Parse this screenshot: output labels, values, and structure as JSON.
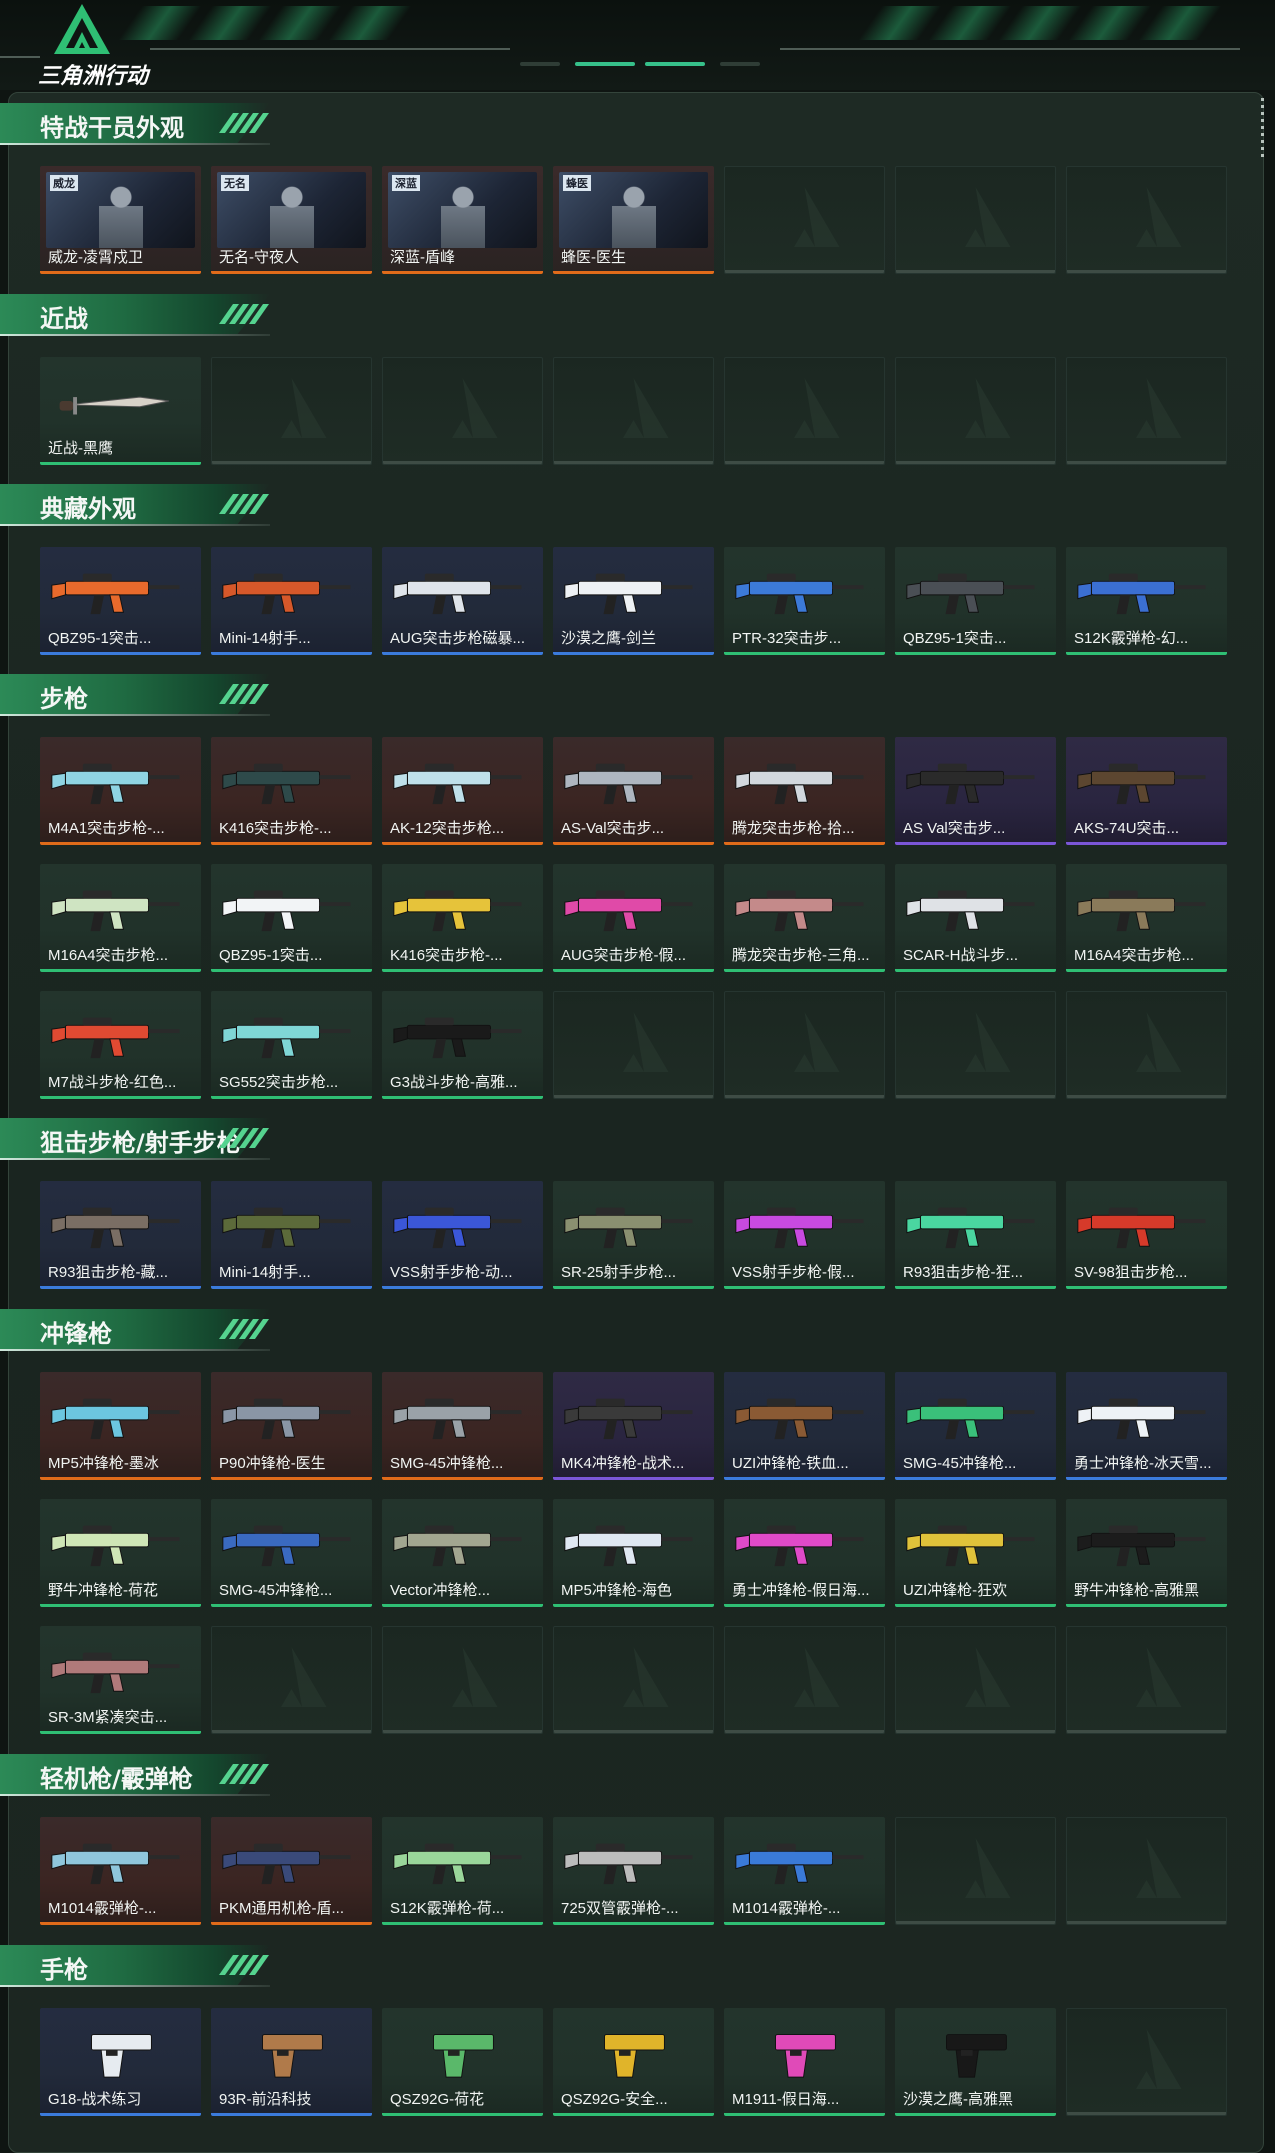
{
  "app": {
    "logo_text": "三角洲行动"
  },
  "colors": {
    "red": "#e06b1a",
    "blue": "#3b7bdc",
    "green": "#2fbf74",
    "purple": "#7b56d8",
    "gold": "#e6a226",
    "section_header": "#1f6b42"
  },
  "sections": [
    {
      "title": "特战干员外观",
      "items": [
        {
          "name": "威龙-凌霄戍卫",
          "rarity": "operator",
          "badge": "威龙"
        },
        {
          "name": "无名-守夜人",
          "rarity": "operator",
          "badge": "无名"
        },
        {
          "name": "深蓝-盾峰",
          "rarity": "operator",
          "badge": "深蓝"
        },
        {
          "name": "蜂医-医生",
          "rarity": "operator",
          "badge": "蜂医"
        },
        null,
        null,
        null
      ]
    },
    {
      "title": "近战",
      "items": [
        {
          "name": "近战-黑鹰",
          "rarity": "green"
        },
        null,
        null,
        null,
        null,
        null,
        null
      ]
    },
    {
      "title": "典藏外观",
      "items": [
        {
          "name": "QBZ95-1突击...",
          "rarity": "blue",
          "color": "#e86a2c"
        },
        {
          "name": "Mini-14射手...",
          "rarity": "blue",
          "color": "#d6582a"
        },
        {
          "name": "AUG突击步枪磁暴...",
          "rarity": "blue",
          "color": "#dfe4ea"
        },
        {
          "name": "沙漠之鹰-剑兰",
          "rarity": "blue",
          "color": "#eef1f4"
        },
        {
          "name": "PTR-32突击步...",
          "rarity": "green",
          "color": "#3c7ad8"
        },
        {
          "name": "QBZ95-1突击...",
          "rarity": "green",
          "color": "#4a4f55"
        },
        {
          "name": "S12K霰弹枪-幻...",
          "rarity": "green",
          "color": "#3b6fd2"
        }
      ]
    },
    {
      "title": "步枪",
      "items": [
        {
          "name": "M4A1突击步枪-...",
          "rarity": "red",
          "color": "#8fd4e3"
        },
        {
          "name": "K416突击步枪-...",
          "rarity": "red",
          "color": "#2e4a4a"
        },
        {
          "name": "AK-12突击步枪...",
          "rarity": "red",
          "color": "#bfe0ea"
        },
        {
          "name": "AS-Val突击步...",
          "rarity": "red",
          "color": "#aeb6c0"
        },
        {
          "name": "腾龙突击步枪-拾...",
          "rarity": "red",
          "color": "#d2d8de"
        },
        {
          "name": "AS Val突击步...",
          "rarity": "purple",
          "color": "#2a2a2a"
        },
        {
          "name": "AKS-74U突击...",
          "rarity": "purple",
          "color": "#5c4630"
        },
        {
          "name": "M16A4突击步枪...",
          "rarity": "green",
          "color": "#cfe4c2"
        },
        {
          "name": "QBZ95-1突击...",
          "rarity": "green",
          "color": "#f2f4f6"
        },
        {
          "name": "K416突击步枪-...",
          "rarity": "green",
          "color": "#e6c33a"
        },
        {
          "name": "AUG突击步枪-假...",
          "rarity": "green",
          "color": "#e04aa8"
        },
        {
          "name": "腾龙突击步枪-三角...",
          "rarity": "green",
          "color": "#c48a8a"
        },
        {
          "name": "SCAR-H战斗步...",
          "rarity": "green",
          "color": "#dfe2e6"
        },
        {
          "name": "M16A4突击步枪...",
          "rarity": "green",
          "color": "#8a7a5a"
        },
        {
          "name": "M7战斗步枪-红色...",
          "rarity": "green",
          "color": "#e04a32"
        },
        {
          "name": "SG552突击步枪...",
          "rarity": "green",
          "color": "#7fd6d6"
        },
        {
          "name": "G3战斗步枪-高雅...",
          "rarity": "green",
          "color": "#1a1a1a"
        },
        null,
        null,
        null,
        null
      ]
    },
    {
      "title": "狙击步枪/射手步枪",
      "items": [
        {
          "name": "R93狙击步枪-藏...",
          "rarity": "blue",
          "color": "#7a6e64"
        },
        {
          "name": "Mini-14射手...",
          "rarity": "blue",
          "color": "#5c6a3a"
        },
        {
          "name": "VSS射手步枪-动...",
          "rarity": "blue",
          "color": "#3b57d8"
        },
        {
          "name": "SR-25射手步枪...",
          "rarity": "green",
          "color": "#8a9070"
        },
        {
          "name": "VSS射手步枪-假...",
          "rarity": "green",
          "color": "#c84ae0"
        },
        {
          "name": "R93狙击步枪-狂...",
          "rarity": "green",
          "color": "#4ad6a0"
        },
        {
          "name": "SV-98狙击步枪...",
          "rarity": "green",
          "color": "#d63a2a"
        }
      ]
    },
    {
      "title": "冲锋枪",
      "items": [
        {
          "name": "MP5冲锋枪-墨冰",
          "rarity": "red",
          "color": "#6cc6e0"
        },
        {
          "name": "P90冲锋枪-医生",
          "rarity": "red",
          "color": "#8a96a6"
        },
        {
          "name": "SMG-45冲锋枪...",
          "rarity": "red",
          "color": "#9aa2a8"
        },
        {
          "name": "MK4冲锋枪-战术...",
          "rarity": "purple",
          "color": "#3a3a3a"
        },
        {
          "name": "UZI冲锋枪-铁血...",
          "rarity": "blue",
          "color": "#8a5a34"
        },
        {
          "name": "SMG-45冲锋枪...",
          "rarity": "blue",
          "color": "#3ac07a"
        },
        {
          "name": "勇士冲锋枪-冰天雪...",
          "rarity": "blue",
          "color": "#eef2f6"
        },
        {
          "name": "野牛冲锋枪-荷花",
          "rarity": "green",
          "color": "#cfe6b6"
        },
        {
          "name": "SMG-45冲锋枪...",
          "rarity": "green",
          "color": "#3a6ac0"
        },
        {
          "name": "Vector冲锋枪...",
          "rarity": "green",
          "color": "#a2a690"
        },
        {
          "name": "MP5冲锋枪-海色",
          "rarity": "green",
          "color": "#dfe8f2"
        },
        {
          "name": "勇士冲锋枪-假日海...",
          "rarity": "green",
          "color": "#e04ac8"
        },
        {
          "name": "UZI冲锋枪-狂欢",
          "rarity": "green",
          "color": "#e0c23a"
        },
        {
          "name": "野牛冲锋枪-高雅黑",
          "rarity": "green",
          "color": "#1c1c1c"
        },
        {
          "name": "SR-3M紧凑突击...",
          "rarity": "green",
          "color": "#b07a7a"
        },
        null,
        null,
        null,
        null,
        null,
        null
      ]
    },
    {
      "title": "轻机枪/霰弹枪",
      "items": [
        {
          "name": "M1014霰弹枪-...",
          "rarity": "red",
          "color": "#8fc6dc"
        },
        {
          "name": "PKM通用机枪-盾...",
          "rarity": "red",
          "color": "#3a4a7a"
        },
        {
          "name": "S12K霰弹枪-荷...",
          "rarity": "green",
          "color": "#9ad69a"
        },
        {
          "name": "725双管霰弹枪-...",
          "rarity": "green",
          "color": "#bcbcbc"
        },
        {
          "name": "M1014霰弹枪-...",
          "rarity": "green",
          "color": "#3a7ad8"
        },
        null,
        null
      ]
    },
    {
      "title": "手枪",
      "items": [
        {
          "name": "G18-战术练习",
          "rarity": "blue",
          "color": "#e6ebf0"
        },
        {
          "name": "93R-前沿科技",
          "rarity": "blue",
          "color": "#b07a4a"
        },
        {
          "name": "QSZ92G-荷花",
          "rarity": "green",
          "color": "#5ab86a"
        },
        {
          "name": "QSZ92G-安全...",
          "rarity": "green",
          "color": "#e0b42a"
        },
        {
          "name": "M1911-假日海...",
          "rarity": "green",
          "color": "#e04ab8"
        },
        {
          "name": "沙漠之鹰-高雅黑",
          "rarity": "green",
          "color": "#181818"
        },
        null
      ]
    }
  ]
}
